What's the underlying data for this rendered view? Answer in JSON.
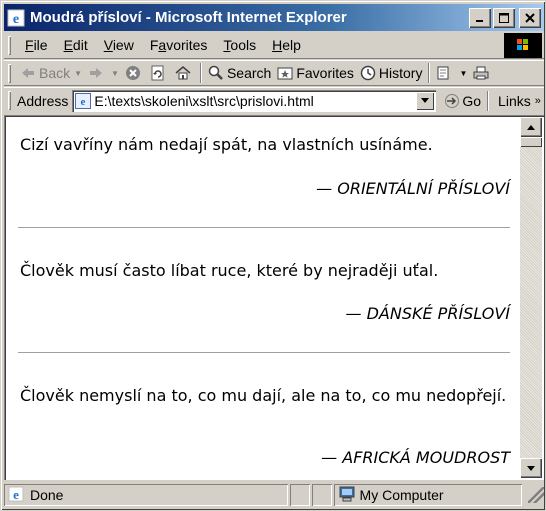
{
  "window": {
    "title": "Moudrá přísloví - Microsoft Internet Explorer",
    "minimize_label": "_",
    "maximize_label": "□",
    "close_label": "✕"
  },
  "menubar": {
    "items": [
      "File",
      "Edit",
      "View",
      "Favorites",
      "Tools",
      "Help"
    ],
    "underline": [
      "F",
      "E",
      "V",
      "a",
      "T",
      "H"
    ]
  },
  "toolbar": {
    "back_label": "Back",
    "search_label": "Search",
    "favorites_label": "Favorites",
    "history_label": "History"
  },
  "addressbar": {
    "label": "Address",
    "url": "E:\\texts\\skoleni\\xslt\\src\\prislovi.html",
    "go_label": "Go",
    "links_label": "Links"
  },
  "content": {
    "quotes": [
      {
        "text": "Cizí vavříny nám nedají spát, na vlastních usínáme.",
        "attribution": "— ORIENTÁLNÍ PŘÍSLOVÍ"
      },
      {
        "text": "Člověk musí často líbat ruce, které by nejraději uťal.",
        "attribution": "— DÁNSKÉ PŘÍSLOVÍ"
      },
      {
        "text": "Člověk nemyslí na to, co mu dají, ale na to, co mu nedopřejí.",
        "attribution": "— AFRICKÁ MOUDROST"
      }
    ]
  },
  "statusbar": {
    "status": "Done",
    "zone": "My Computer"
  },
  "colors": {
    "title_gradient_start": "#0a246a",
    "title_gradient_end": "#a6caf0",
    "chrome": "#d4d0c8"
  },
  "icons": [
    "ie-icon",
    "windows-logo-icon",
    "back-arrow-icon",
    "forward-arrow-icon",
    "stop-icon",
    "refresh-icon",
    "home-icon",
    "search-icon",
    "favorites-icon",
    "history-icon",
    "mail-icon",
    "print-icon",
    "page-icon",
    "go-arrow-icon",
    "computer-icon"
  ]
}
